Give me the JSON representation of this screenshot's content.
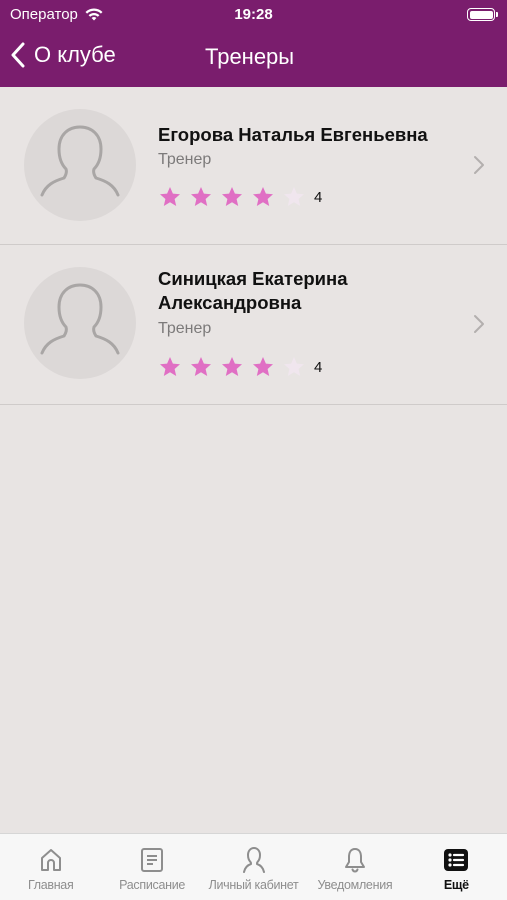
{
  "status_bar": {
    "carrier": "Оператор",
    "time": "19:28"
  },
  "nav": {
    "back_label": "О клубе",
    "title": "Тренеры"
  },
  "colors": {
    "brand": "#7a1d6d",
    "star_filled": "#e06fc4",
    "star_empty": "#f0e6ee",
    "background": "#e8e4e3"
  },
  "trainers": [
    {
      "name": "Егорова Наталья Евгеньевна",
      "role": "Тренер",
      "rating": 4,
      "rating_text": "4"
    },
    {
      "name": "Синицкая Екатерина Александровна",
      "role": "Тренер",
      "rating": 4,
      "rating_text": "4"
    }
  ],
  "tabs": [
    {
      "label": "Главная",
      "icon": "home-icon",
      "active": false
    },
    {
      "label": "Расписание",
      "icon": "schedule-icon",
      "active": false
    },
    {
      "label": "Личный кабинет",
      "icon": "profile-icon",
      "active": false
    },
    {
      "label": "Уведомления",
      "icon": "bell-icon",
      "active": false
    },
    {
      "label": "Ещё",
      "icon": "more-list-icon",
      "active": true
    }
  ]
}
